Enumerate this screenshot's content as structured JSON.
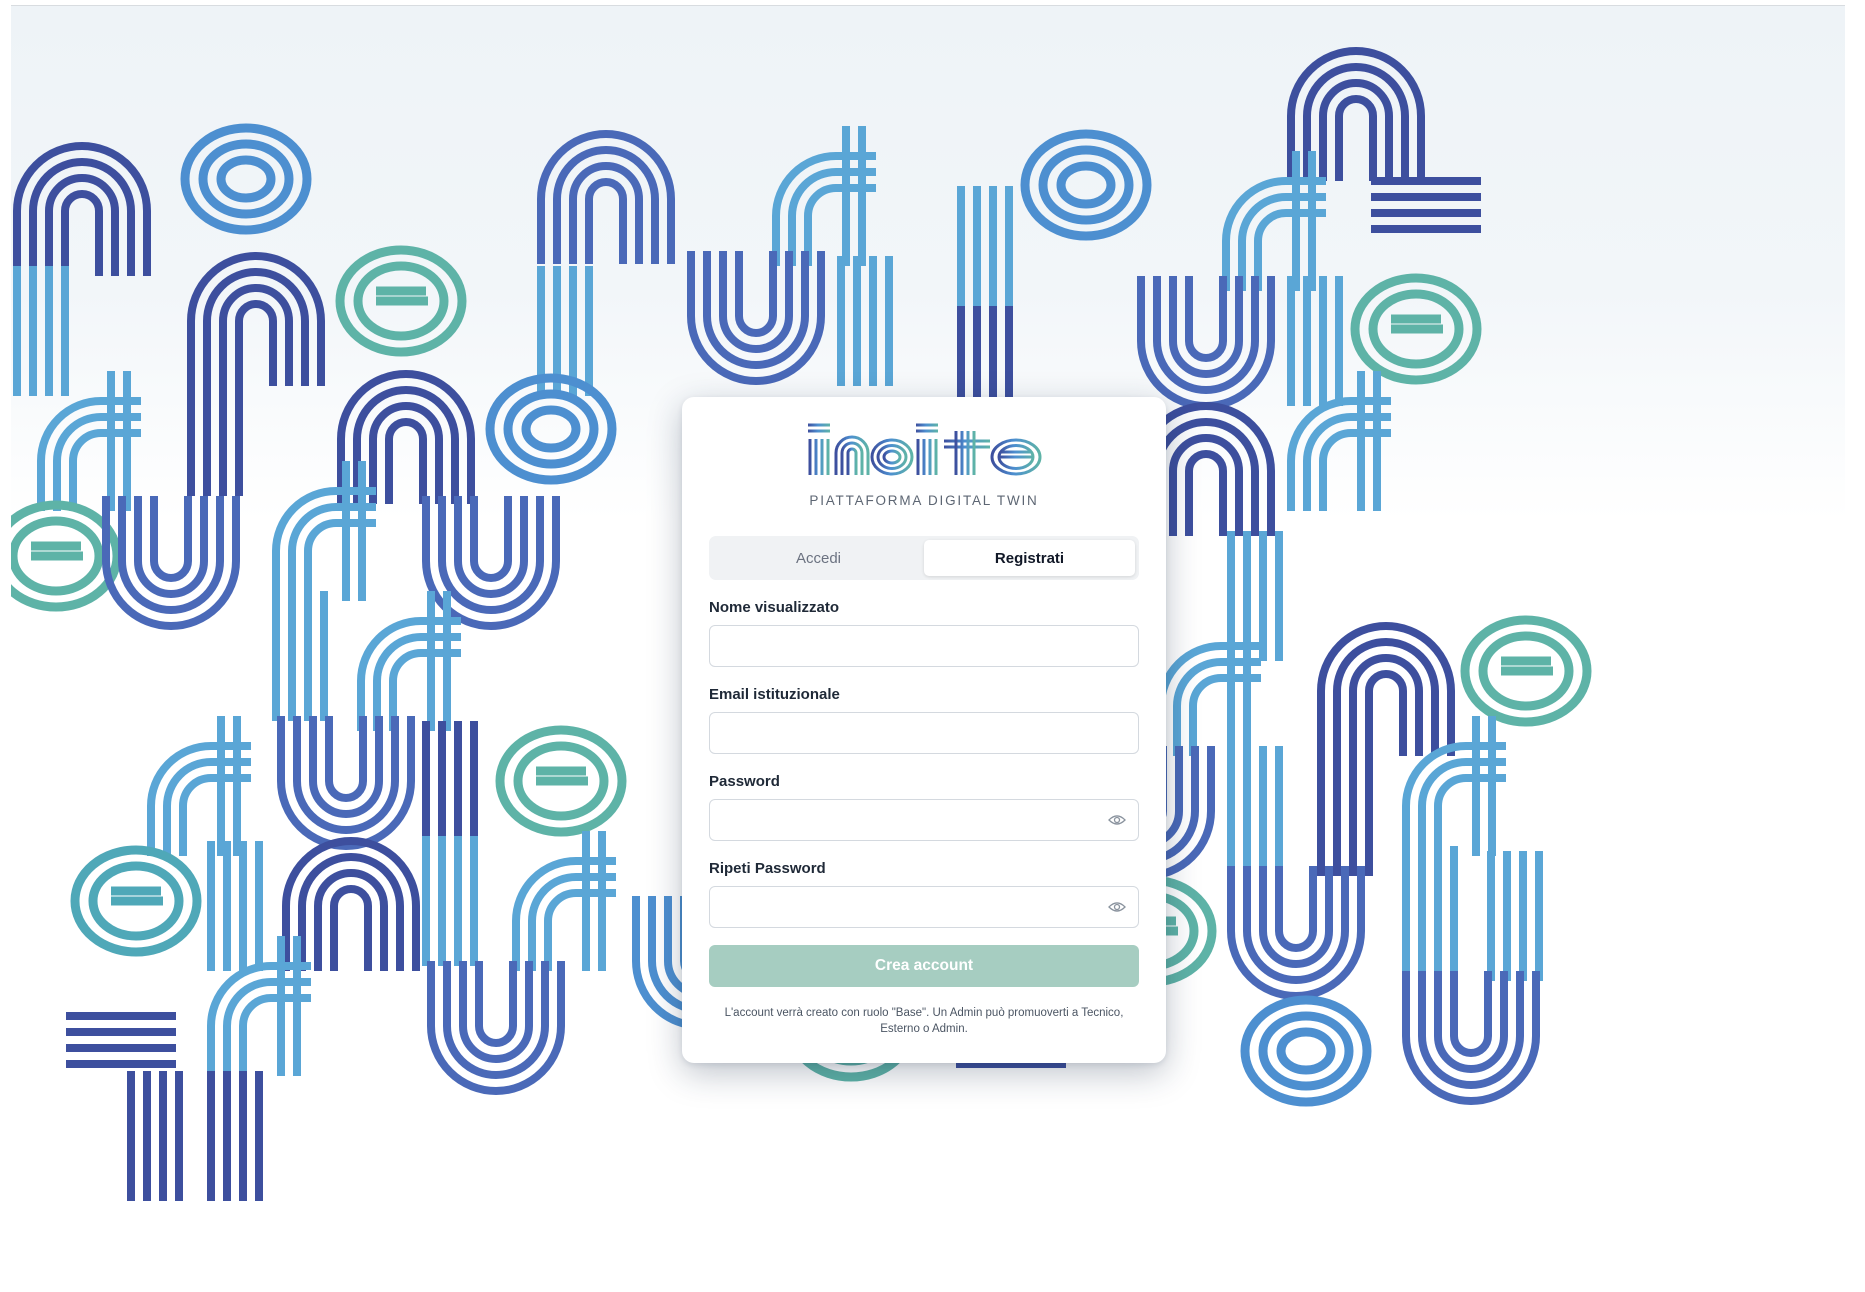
{
  "brand": {
    "logo_text": "incite",
    "subtitle": "PIATTAFORMA DIGITAL TWIN",
    "colors": {
      "navy": "#3d4f9e",
      "blue": "#5b8fd1",
      "sky": "#5aa6d6",
      "teal": "#5eb3a7",
      "button_disabled": "#a6cdc1"
    }
  },
  "tabs": [
    {
      "label": "Accedi",
      "active": false
    },
    {
      "label": "Registrati",
      "active": true
    }
  ],
  "form": {
    "display_name": {
      "label": "Nome visualizzato",
      "value": "",
      "placeholder": ""
    },
    "email": {
      "label": "Email istituzionale",
      "value": "",
      "placeholder": ""
    },
    "password": {
      "label": "Password",
      "value": "",
      "placeholder": "",
      "icon": "eye-icon"
    },
    "repeat_password": {
      "label": "Ripeti Password",
      "value": "",
      "placeholder": "",
      "icon": "eye-icon"
    },
    "submit_label": "Crea account",
    "note": "L'account verrà creato con ruolo \"Base\". Un Admin può promuoverti a Tecnico, Esterno o Admin."
  }
}
